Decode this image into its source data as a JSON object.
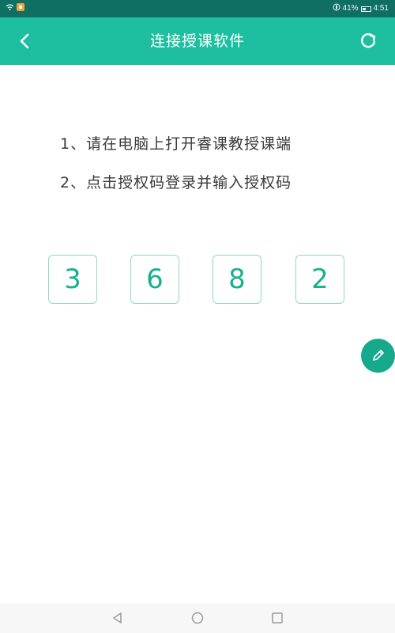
{
  "status_bar": {
    "battery_text": "41%",
    "time": "4:51",
    "battery_level": 0.41
  },
  "header": {
    "title": "连接授课软件"
  },
  "instructions": [
    "1、请在电脑上打开睿课教授课端",
    "2、点击授权码登录并输入授权码"
  ],
  "auth_code": {
    "digits": [
      "3",
      "6",
      "8",
      "2"
    ]
  },
  "icons": {
    "back": "chevron-left",
    "refresh": "refresh",
    "edit": "pencil",
    "nav_back": "triangle-back",
    "nav_home": "circle-home",
    "nav_recent": "square-recent"
  },
  "colors": {
    "status_bar": "#0f6f62",
    "app_bar": "#1dbfa0",
    "accent": "#16a98c",
    "code_border": "#8fd8c9",
    "code_text": "#18b08d",
    "instruction_text": "#3a3a3a"
  }
}
